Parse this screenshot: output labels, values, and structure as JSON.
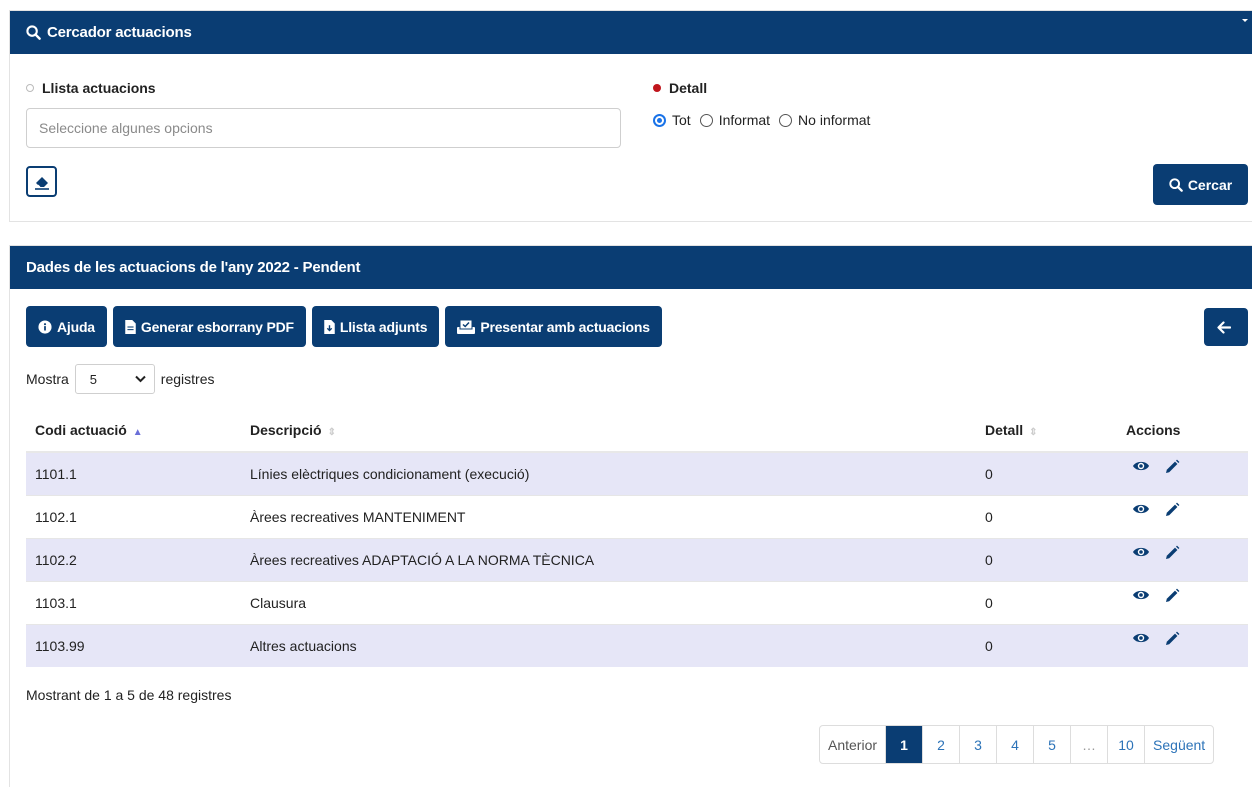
{
  "search": {
    "title": "Cercador actuacions",
    "list_label": "Llista actuacions",
    "list_placeholder": "Seleccione algunes opcions",
    "detail_label": "Detall",
    "radio_options": [
      "Tot",
      "Informat",
      "No informat"
    ],
    "selected_radio": "Tot",
    "search_button": "Cercar"
  },
  "data_panel": {
    "title": "Dades de les actuacions de l'any 2022 - Pendent",
    "buttons": {
      "help": "Ajuda",
      "pdf": "Generar esborrany PDF",
      "attachments": "Llista adjunts",
      "present": "Presentar amb actuacions"
    },
    "length": {
      "prefix": "Mostra",
      "value": "5",
      "suffix": "registres"
    },
    "columns": [
      "Codi actuació",
      "Descripció",
      "Detall",
      "Accions"
    ],
    "rows": [
      {
        "code": "1101.1",
        "desc": "Línies elèctriques condicionament (execució)",
        "detail": "0"
      },
      {
        "code": "1102.1",
        "desc": "Àrees recreatives MANTENIMENT",
        "detail": "0"
      },
      {
        "code": "1102.2",
        "desc": "Àrees recreatives ADAPTACIÓ A LA NORMA TÈCNICA",
        "detail": "0"
      },
      {
        "code": "1103.1",
        "desc": "Clausura",
        "detail": "0"
      },
      {
        "code": "1103.99",
        "desc": "Altres actuacions",
        "detail": "0"
      }
    ],
    "info": "Mostrant de 1 a 5 de 48 registres",
    "pagination": {
      "prev": "Anterior",
      "pages": [
        "1",
        "2",
        "3",
        "4",
        "5",
        "…",
        "10"
      ],
      "next": "Següent",
      "current": "1"
    }
  },
  "colors": {
    "primary": "#0a3d73",
    "row_stripe": "#e6e6f7",
    "radio_active": "#1a73e8",
    "detail_dot": "#c0151c"
  }
}
